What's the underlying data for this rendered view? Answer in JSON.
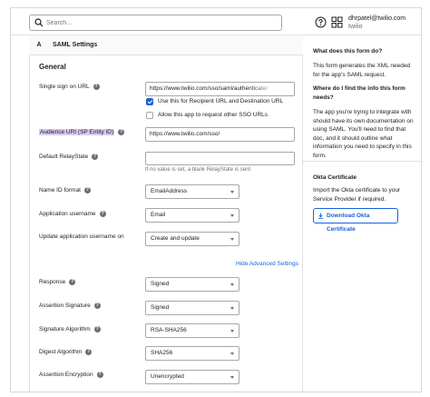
{
  "search": {
    "placeholder": "Search..."
  },
  "user": {
    "email": "dhrpatel@twilio.com",
    "org": "twilio"
  },
  "section": {
    "badge": "A",
    "title": "SAML Settings"
  },
  "general": {
    "title": "General"
  },
  "fields": {
    "sso_url": {
      "label": "Single sign on URL",
      "value": "https://www.twilio.com/sso/saml/authenticate/"
    },
    "recipient_checkbox": {
      "label": "Use this for Recipient URL and Destination URL",
      "checked": true
    },
    "other_sso_checkbox": {
      "label": "Allow this app to request other SSO URLs",
      "checked": false
    },
    "audience_uri": {
      "label": "Audience URI (SP Entity ID)",
      "value": "https://www.twilio.com/sso/"
    },
    "relay_state": {
      "label": "Default RelayState",
      "value": "",
      "hint": "If no value is set, a blank RelayState is sent"
    },
    "name_id_format": {
      "label": "Name ID format",
      "value": "EmailAddress"
    },
    "app_username": {
      "label": "Application username",
      "value": "Email"
    },
    "update_username": {
      "label": "Update application username on",
      "value": "Create and update"
    },
    "advanced_link": "Hide Advanced Settings",
    "response": {
      "label": "Response",
      "value": "Signed"
    },
    "assertion_signature": {
      "label": "Assertion Signature",
      "value": "Signed"
    },
    "signature_algorithm": {
      "label": "Signature Algorithm",
      "value": "RSA-SHA256"
    },
    "digest_algorithm": {
      "label": "Digest Algorithm",
      "value": "SHA256"
    },
    "assertion_encryption": {
      "label": "Assertion Encryption",
      "value": "Unencrypted"
    }
  },
  "sidebar": {
    "q1_title": "What does this form do?",
    "q1_body": "This form generates the XML needed for the app's SAML request.",
    "q2_title": "Where do I find the info this form needs?",
    "q2_body": "The app you're trying to integrate with should have its own documentation on using SAML. You'll need to find that doc, and it should outline what information you need to specify in this form.",
    "cert_title": "Okta Certificate",
    "cert_body": "Import the Okta certificate to your Service Provider if required.",
    "download_label": "Download Okta Certificate"
  },
  "icons": {
    "search": "search-icon",
    "help": "help-circle-icon",
    "apps": "app-grid-icon",
    "download": "download-icon",
    "info": "info-icon"
  },
  "colors": {
    "accent": "#1662dd",
    "highlight": "#d9c9f2",
    "border": "#a7a7ad"
  }
}
